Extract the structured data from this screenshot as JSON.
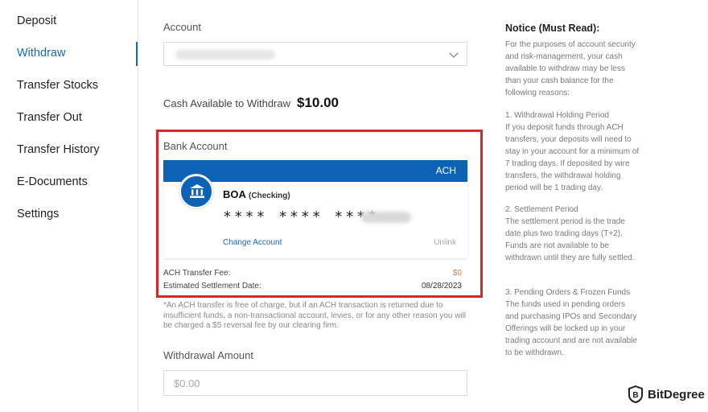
{
  "sidebar": {
    "items": [
      {
        "label": "Deposit"
      },
      {
        "label": "Withdraw"
      },
      {
        "label": "Transfer Stocks"
      },
      {
        "label": "Transfer Out"
      },
      {
        "label": "Transfer History"
      },
      {
        "label": "E-Documents"
      },
      {
        "label": "Settings"
      }
    ],
    "active_item": "Withdraw"
  },
  "account": {
    "label": "Account",
    "selected_value": ""
  },
  "cash": {
    "label": "Cash Available to Withdraw",
    "value": "$10.00"
  },
  "bank_account": {
    "label": "Bank Account",
    "method_tag": "ACH",
    "bank_name": "BOA",
    "account_type": "(Checking)",
    "masked_number": "**** **** ****",
    "change_label": "Change Account",
    "unlink_label": "Unlink"
  },
  "fees": {
    "fee_label": "ACH Transfer Fee:",
    "fee_value": "$0",
    "settlement_label": "Estimated Settlement Date:",
    "settlement_value": "08/28/2023"
  },
  "ach_note": "*An ACH transfer is free of charge, but if an ACH transaction is returned due to insufficient funds, a non-transactional account, levies, or for any other reason you will be charged a $5 reversal fee by our clearing firm.",
  "withdrawal_amount": {
    "label": "Withdrawal Amount",
    "placeholder": "$0.00"
  },
  "notice": {
    "title": "Notice (Must Read):",
    "intro": "For the purposes of account security and risk-management, your cash available to withdraw may be less than your cash balance for the following reasons:",
    "sections": [
      {
        "heading": "1. Withdrawal Holding Period",
        "body": "If you deposit funds through ACH transfers, your deposits will need to stay in your account for a minimum of 7 trading days. If deposited by wire transfers, the withdrawal holding period will be 1 trading day."
      },
      {
        "heading": "2. Settlement Period",
        "body": "The settlement period is the trade date plus two trading days (T+2). Funds are not available to be withdrawn until they are fully settled."
      },
      {
        "heading": "3. Pending Orders & Frozen Funds",
        "body": "The funds used in pending orders and purchasing IPOs and Secondary Offerings will be locked up in your trading account and are not available to be withdrawn."
      }
    ]
  },
  "watermark": {
    "text": "BitDegree"
  },
  "colors": {
    "accent": "#1a67b8",
    "card_band": "#0e62b3",
    "highlight": "#d8262c",
    "fee_value": "#e07a3a"
  }
}
